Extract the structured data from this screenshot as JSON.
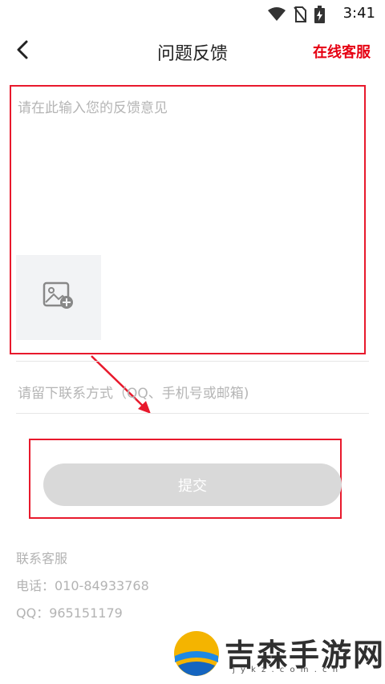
{
  "status_bar": {
    "time": "3:41",
    "icons": [
      "wifi-icon",
      "no-sim-icon",
      "battery-charging-icon"
    ]
  },
  "header": {
    "back_icon": "chevron-left-icon",
    "title": "问题反馈",
    "online_service_label": "在线客服"
  },
  "feedback": {
    "placeholder": "请在此输入您的反馈意见",
    "value": "",
    "add_image_icon": "image-add-icon"
  },
  "contact": {
    "placeholder": "请留下联系方式（QQ、手机号或邮箱)",
    "value": ""
  },
  "submit": {
    "label": "提交"
  },
  "service_info": {
    "title": "联系客服",
    "phone": "电话：010-84933768",
    "qq": "QQ：965151179"
  },
  "watermark": {
    "text": "吉森手游网",
    "url": "j y k z . c o m . c n"
  },
  "colors": {
    "accent": "#e60012",
    "annotation": "#e8192c",
    "button_disabled": "#d9d9d9",
    "placeholder": "#b5b5b5"
  }
}
